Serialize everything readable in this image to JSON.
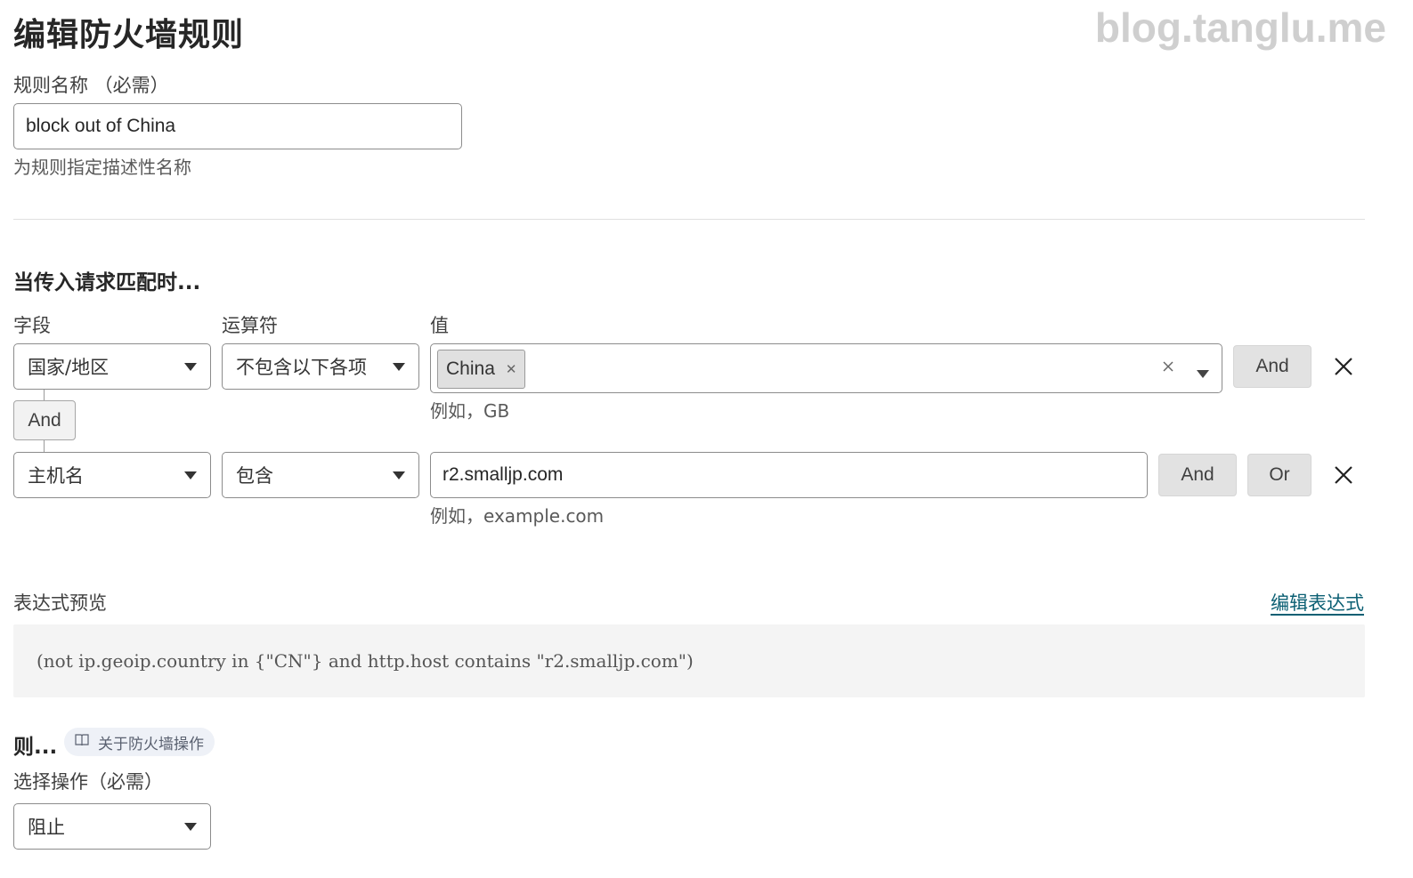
{
  "page": {
    "title": "编辑防火墙规则",
    "watermark": "blog.tanglu.me"
  },
  "rule_name": {
    "label": "规则名称 （必需）",
    "value": "block out of China",
    "hint": "为规则指定描述性名称"
  },
  "match": {
    "section_title": "当传入请求匹配时...",
    "headers": {
      "field": "字段",
      "operator": "运算符",
      "value": "值"
    },
    "connector_label": "And",
    "rows": [
      {
        "field": "国家/地区",
        "operator": "不包含以下各项",
        "value_tag": "China",
        "hint": "例如，GB",
        "and_label": "And"
      },
      {
        "field": "主机名",
        "operator": "包含",
        "value": "r2.smalljp.com",
        "hint": "例如，example.com",
        "and_label": "And",
        "or_label": "Or"
      }
    ]
  },
  "expression": {
    "label": "表达式预览",
    "edit_link": "编辑表达式",
    "text": "(not ip.geoip.country in {\"CN\"} and http.host contains \"r2.smalljp.com\")"
  },
  "action": {
    "section_title": "则...",
    "doc_link": "关于防火墙操作",
    "select_label": "选择操作（必需）",
    "selected": "阻止"
  }
}
